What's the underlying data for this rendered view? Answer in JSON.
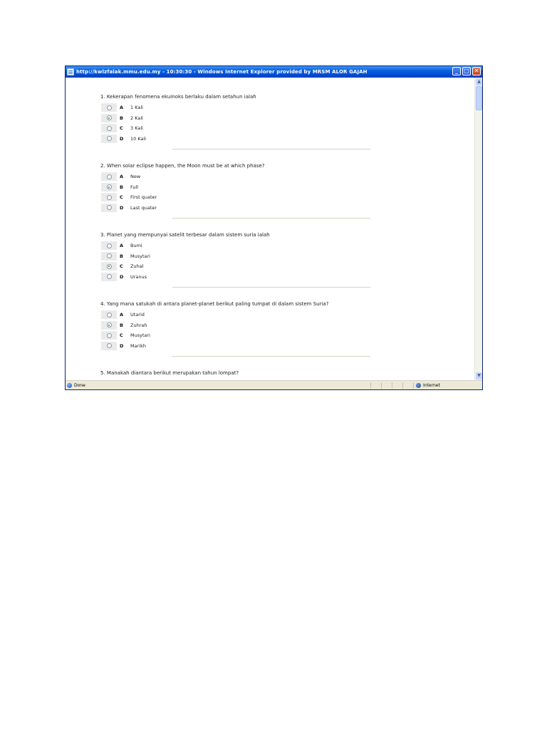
{
  "window": {
    "title": "http://kwlzfalak.mmu.edu.my - 10:30:30 - Windows Internet Explorer provided by MRSM ALOR GAJAH",
    "minimize": "_",
    "maximize": "□",
    "close": "✕"
  },
  "questions": [
    {
      "text": "1. Kekerapan fenomena ekuinoks berlaku dalam setahun ialah",
      "options": [
        {
          "letter": "A",
          "text": "1 Kali",
          "checked": false
        },
        {
          "letter": "B",
          "text": "2 Kali",
          "checked": true
        },
        {
          "letter": "C",
          "text": "3 Kali",
          "checked": false
        },
        {
          "letter": "D",
          "text": "10 Kali",
          "checked": false
        }
      ]
    },
    {
      "text": "2. When solar eclipse happen, the Moon must be at which phase?",
      "options": [
        {
          "letter": "A",
          "text": "New",
          "checked": false
        },
        {
          "letter": "B",
          "text": "Full",
          "checked": true
        },
        {
          "letter": "C",
          "text": "First quater",
          "checked": false
        },
        {
          "letter": "D",
          "text": "Last quater",
          "checked": false
        }
      ]
    },
    {
      "text": "3. Planet yang mempunyai satelit terbesar dalam sistem suria ialah",
      "options": [
        {
          "letter": "A",
          "text": "Bumi",
          "checked": false
        },
        {
          "letter": "B",
          "text": "Musytari",
          "checked": false
        },
        {
          "letter": "C",
          "text": "Zuhal",
          "checked": true
        },
        {
          "letter": "D",
          "text": "Uranus",
          "checked": false
        }
      ]
    },
    {
      "text": "4. Yang mana satukah di antara planet-planet berikut paling tumpat di dalam sistem Suria?",
      "options": [
        {
          "letter": "A",
          "text": "Utarid",
          "checked": false
        },
        {
          "letter": "B",
          "text": "Zuhrah",
          "checked": true
        },
        {
          "letter": "C",
          "text": "Musytari",
          "checked": false
        },
        {
          "letter": "D",
          "text": "Marikh",
          "checked": false
        }
      ]
    },
    {
      "text": "5. Manakah diantara berikut merupakan tahun lompat?",
      "options": []
    }
  ],
  "status": {
    "left": "Done",
    "zone": "Internet"
  }
}
